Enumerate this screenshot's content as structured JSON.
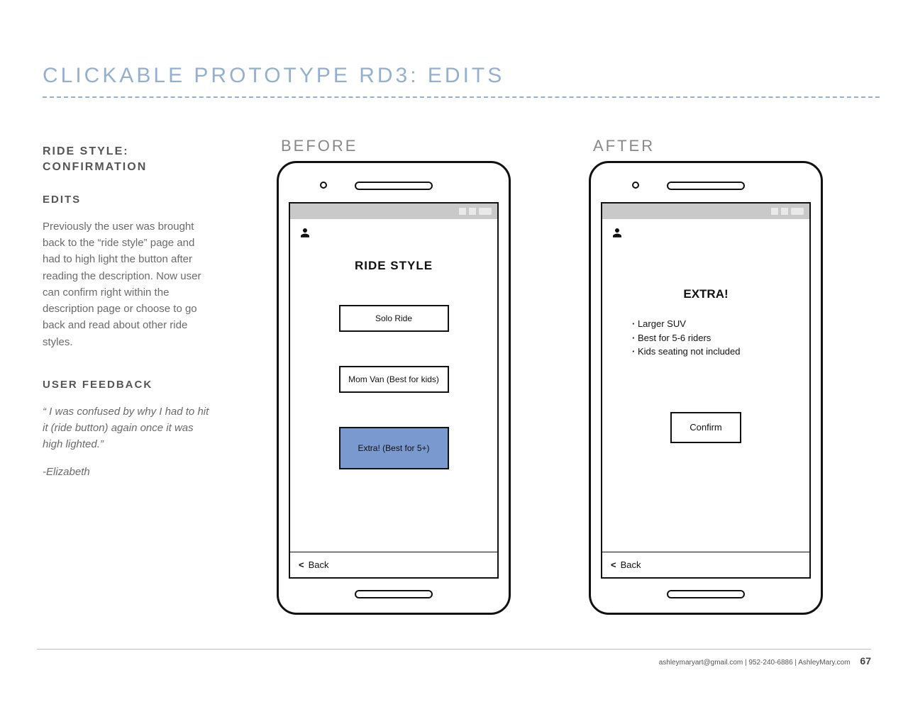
{
  "page_title": "CLICKABLE PROTOTYPE RD3: EDITS",
  "left": {
    "subtitle": "RIDE STYLE:\nCONFIRMATION",
    "edits_label": "EDITS",
    "edits_body": "Previously the user was brought back to the “ride style” page and had to high light the button after reading the description. Now user can confirm right within the description page or choose to go back and read about other ride styles.",
    "feedback_label": "USER FEEDBACK",
    "quote": "“ I was confused by why I had to hit it (ride button) again once it was high lighted.”",
    "attribution": "-Elizabeth"
  },
  "before": {
    "label": "BEFORE",
    "screen_title": "RIDE STYLE",
    "option1": "Solo Ride",
    "option2": "Mom Van (Best for kids)",
    "option3": "Extra! (Best for 5+)",
    "back": "Back"
  },
  "after": {
    "label": "AFTER",
    "screen_title": "EXTRA!",
    "bullet1": "Larger SUV",
    "bullet2": "Best for 5-6 riders",
    "bullet3": "Kids seating not included",
    "confirm": "Confirm",
    "back": "Back"
  },
  "footer": {
    "contact": "ashleymaryart@gmail.com | 952-240-6886 | AshleyMary.com",
    "page": "67"
  }
}
